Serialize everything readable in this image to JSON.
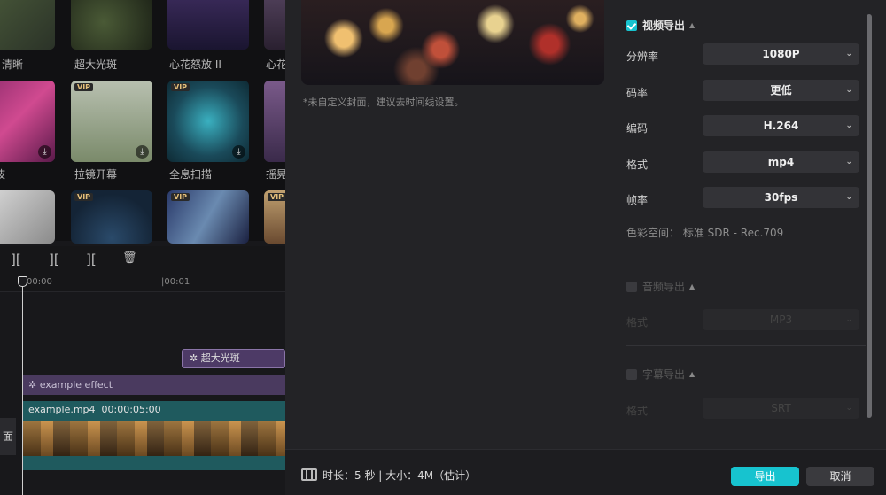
{
  "library": {
    "labels": [
      "清晰",
      "超大光斑",
      "心花怒放 II",
      "心花",
      "波",
      "拉镜开幕",
      "全息扫描",
      "摇晃"
    ],
    "vip_badge": "VIP",
    "download_glyph": "⤓"
  },
  "timeline": {
    "toolbar_glyphs": [
      "][",
      "][",
      "][",
      "🗑"
    ],
    "ruler_ticks": [
      "00:00",
      "|00:01"
    ],
    "effect_clip_top": "超大光斑",
    "effect_clip": "example effect",
    "effect_glyph": "✲",
    "video_clip_name": "example.mp4",
    "video_clip_duration": "00:00:05:00",
    "cover_tab": "面"
  },
  "export": {
    "preview_note": "*未自定义封面，建议去时间线设置。",
    "video_section": {
      "title": "视频导出",
      "checked": true,
      "rows": [
        {
          "label": "分辨率",
          "value": "1080P"
        },
        {
          "label": "码率",
          "value": "更低"
        },
        {
          "label": "编码",
          "value": "H.264"
        },
        {
          "label": "格式",
          "value": "mp4"
        },
        {
          "label": "帧率",
          "value": "30fps"
        }
      ],
      "color_space": "色彩空间：  标准 SDR - Rec.709"
    },
    "audio_section": {
      "title": "音频导出",
      "checked": false,
      "row": {
        "label": "格式",
        "value": "MP3"
      }
    },
    "subtitle_section": {
      "title": "字幕导出",
      "checked": false,
      "row": {
        "label": "格式",
        "value": "SRT"
      }
    },
    "chevron": "⌄",
    "caret_up": "▲"
  },
  "footer": {
    "info": "时长：5 秒 | 大小：4M（估计）",
    "export_button": "导出",
    "cancel_button": "取消"
  },
  "colors": {
    "accent": "#17c3cf",
    "panel": "#232326",
    "select": "#333337"
  }
}
